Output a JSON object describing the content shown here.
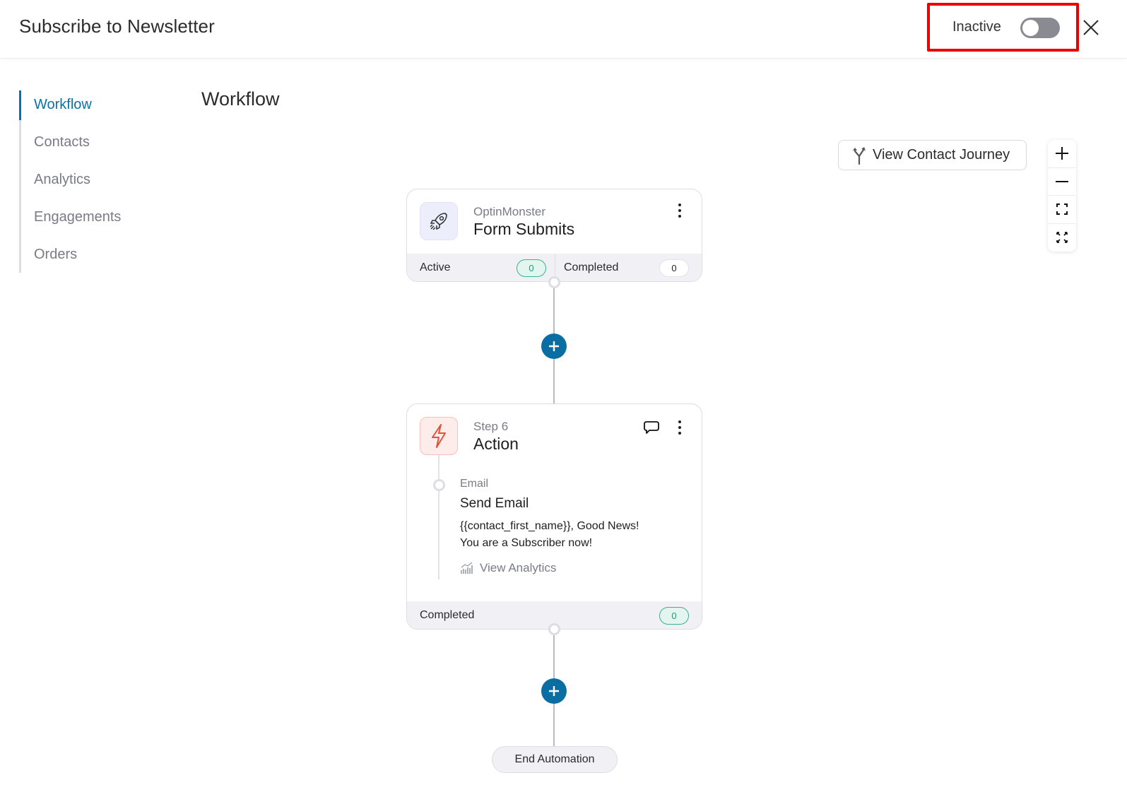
{
  "header": {
    "title": "Subscribe to Newsletter",
    "status_label": "Inactive",
    "toggle_on": false,
    "close_icon": "close-icon"
  },
  "sidebar": {
    "items": [
      {
        "label": "Workflow",
        "active": true
      },
      {
        "label": "Contacts",
        "active": false
      },
      {
        "label": "Analytics",
        "active": false
      },
      {
        "label": "Engagements",
        "active": false
      },
      {
        "label": "Orders",
        "active": false
      }
    ]
  },
  "main": {
    "title": "Workflow",
    "journey_button": {
      "label": "View Contact Journey",
      "icon": "branch-arrows-icon"
    },
    "zoom_controls": [
      {
        "name": "zoom-in",
        "icon": "plus-icon"
      },
      {
        "name": "zoom-out",
        "icon": "minus-icon"
      },
      {
        "name": "fit-view",
        "icon": "frame-corners-icon"
      },
      {
        "name": "fullscreen",
        "icon": "expand-arrows-icon"
      }
    ]
  },
  "trigger_card": {
    "icon": "rocket-icon",
    "subtitle": "OptinMonster",
    "title": "Form Submits",
    "active_label": "Active",
    "active_count": "0",
    "completed_label": "Completed",
    "completed_count": "0"
  },
  "action_card": {
    "icon": "lightning-icon",
    "subtitle": "Step 6",
    "title": "Action",
    "step": {
      "type": "Email",
      "title": "Send Email",
      "subject": "{{contact_first_name}}, Good News! You are a Subscriber now!",
      "subject_line1": "{{contact_first_name}}, Good News!",
      "subject_line2": "You are a Subscriber now!",
      "analytics_link": "View Analytics"
    },
    "completed_label": "Completed",
    "completed_count": "0"
  },
  "end": {
    "label": "End Automation"
  },
  "colors": {
    "accent": "#0a72a6",
    "add_button": "#0a6ea3",
    "highlight_box": "#ea0000",
    "success": "#1e9c7a",
    "action_icon": "#e0533a",
    "toggle_off": "#8a8b92"
  }
}
